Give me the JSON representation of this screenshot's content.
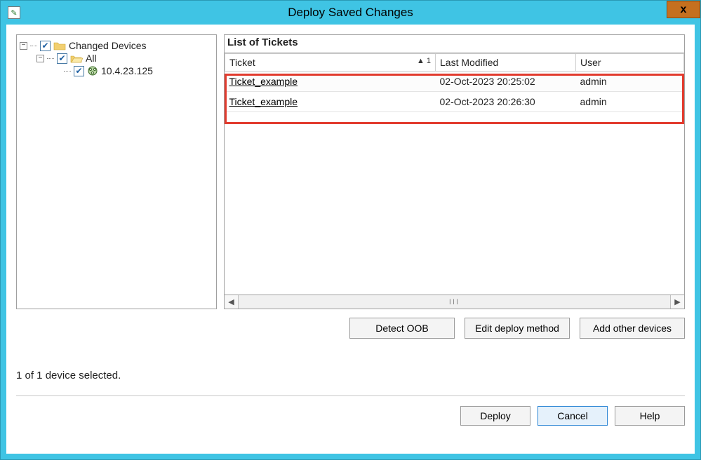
{
  "window": {
    "title": "Deploy Saved Changes",
    "close_glyph": "x"
  },
  "tree": {
    "root": {
      "label": "Changed Devices",
      "checked": true,
      "expander": "−",
      "children": {
        "all": {
          "label": "All",
          "checked": true,
          "expander": "−",
          "device": {
            "label": "10.4.23.125",
            "checked": true
          }
        }
      }
    }
  },
  "list": {
    "title": "List of Tickets",
    "columns": {
      "ticket": "Ticket",
      "last_modified": "Last Modified",
      "user": "User"
    },
    "sort_indicator": "▲ 1",
    "rows": [
      {
        "ticket": "Ticket_example",
        "last_modified": "02-Oct-2023 20:25:02",
        "user": "admin"
      },
      {
        "ticket": "Ticket_example",
        "last_modified": "02-Oct-2023 20:26:30",
        "user": "admin"
      }
    ],
    "scroll_grip": "III"
  },
  "buttons": {
    "detect_oob": "Detect OOB",
    "edit_deploy_method": "Edit deploy method",
    "add_other_devices": "Add other devices",
    "deploy": "Deploy",
    "cancel": "Cancel",
    "help": "Help"
  },
  "status": "1 of 1 device selected.",
  "colors": {
    "accent": "#3fc4e4",
    "highlight": "#e23b2e"
  }
}
